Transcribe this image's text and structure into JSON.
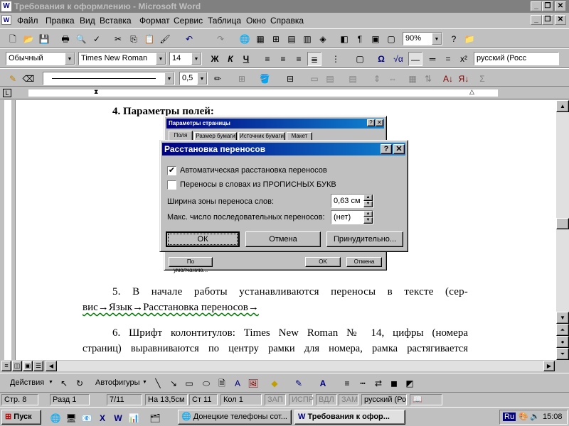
{
  "window": {
    "title": "Требования к оформлению - Microsoft Word"
  },
  "menu": [
    "Файл",
    "Правка",
    "Вид",
    "Вставка",
    "Формат",
    "Сервис",
    "Таблица",
    "Окно",
    "Справка"
  ],
  "formatting": {
    "style": "Обычный",
    "font": "Times New Roman",
    "size": "14",
    "lang": "русский (Росс"
  },
  "standard": {
    "zoom": "90%"
  },
  "drawing_bar": {
    "line_weight": "0,5"
  },
  "document": {
    "heading": "4.  Параметры полей:",
    "p5_line1": "5. В начале работы устанавливаются переносы в тексте (сер-",
    "p5_line2": "вис→Язык→Расстановка переносов→",
    "p6_line1": "6. Шрифт колонтитулов: Times New Roman № 14, цифры (номера",
    "p6_line2": "страниц) выравниваются по центру рамки для номера, рамка растягивается"
  },
  "page_setup": {
    "title": "Параметры страницы",
    "tabs": [
      "Поля",
      "Размер бумаги",
      "Источник бумаги",
      "Макет"
    ],
    "default_btn": "По умолчанию...",
    "ok": "OK",
    "cancel": "Отмена"
  },
  "hyphenation": {
    "title": "Расстановка переносов",
    "auto_label": "Автоматическая расстановка переносов",
    "auto_checked": true,
    "caps_label": "Переносы в словах из ПРОПИСНЫХ БУКВ",
    "caps_checked": false,
    "zone_label": "Ширина зоны переноса слов:",
    "zone_value": "0,63 см",
    "max_label": "Макс. число последовательных переносов:",
    "max_value": "(нет)",
    "ok": "ОК",
    "cancel": "Отмена",
    "manual": "Принудительно..."
  },
  "draw": {
    "actions": "Действия",
    "autoshapes": "Автофигуры"
  },
  "status": {
    "page": "Стр. 8",
    "section": "Разд 1",
    "pages": "7/11",
    "at": "На 13,5см",
    "line": "Ст 11",
    "col": "Кол 1",
    "rec": "ЗАП",
    "trk": "ИСПР",
    "ext": "ВДЛ",
    "ovr": "ЗАМ",
    "lang": "русский (Ро"
  },
  "taskbar": {
    "start": "Пуск",
    "task1": "Донецкие телефоны сот...",
    "task2": "Требования к офор...",
    "lang": "Ru",
    "clock": "15:08"
  }
}
